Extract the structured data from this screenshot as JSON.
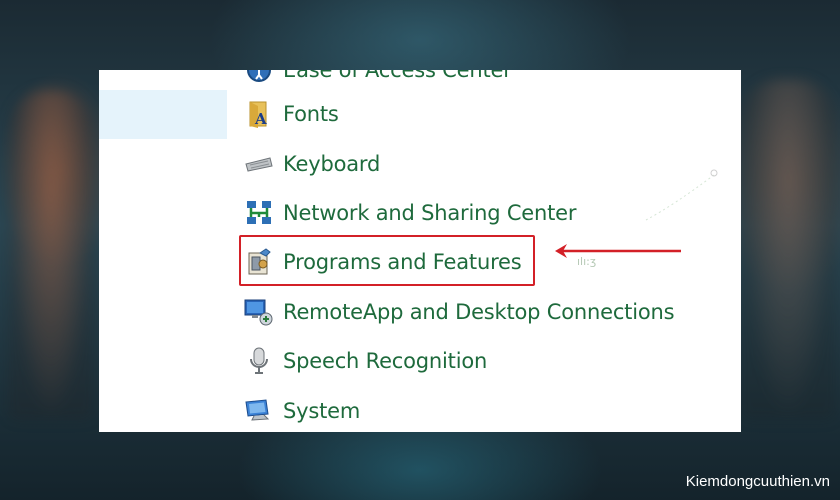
{
  "control_panel": {
    "items": [
      {
        "label": "Ease of Access Center",
        "icon": "ease-of-access-icon"
      },
      {
        "label": "Fonts",
        "icon": "fonts-folder-icon"
      },
      {
        "label": "Keyboard",
        "icon": "keyboard-icon"
      },
      {
        "label": "Network and Sharing Center",
        "icon": "network-icon"
      },
      {
        "label": "Programs and Features",
        "icon": "programs-features-icon"
      },
      {
        "label": "RemoteApp and Desktop Connections",
        "icon": "remoteapp-icon"
      },
      {
        "label": "Speech Recognition",
        "icon": "microphone-icon"
      },
      {
        "label": "System",
        "icon": "system-monitor-icon"
      }
    ]
  },
  "annotation": {
    "highlight_color": "#d32027",
    "scribble_text": "ılı:ʒ"
  },
  "watermark": "Kiemdongcuuthien.vn",
  "colors": {
    "link_text": "#1e6a3c",
    "selection_bg": "#e5f3fb"
  }
}
